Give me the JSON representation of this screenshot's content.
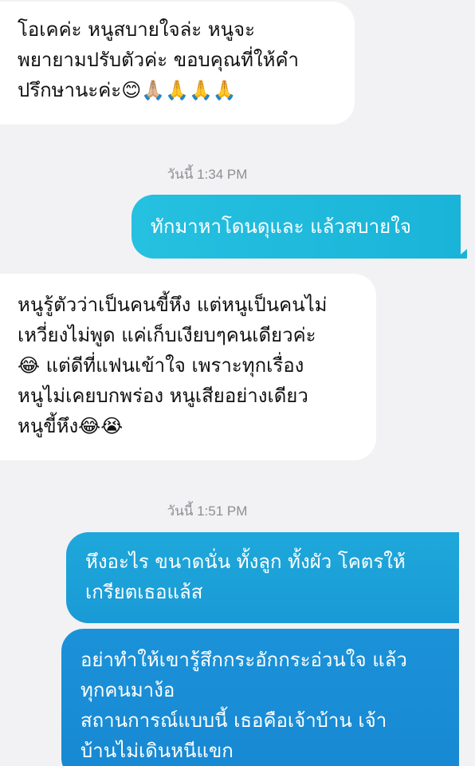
{
  "messages": [
    {
      "direction": "incoming",
      "text": "โอเคค่ะ หนูสบายใจล่ะ หนูจะ\nพยายามปรับตัวค่ะ ขอบคุณที่ให้คำ\nปรึกษานะค่ะ😊🙏🏼🙏🙏🙏"
    },
    {
      "direction": "outgoing",
      "text": "ทักมาหาโดนดุและ แล้วสบายใจ"
    },
    {
      "direction": "incoming",
      "text": "หนูรู้ตัวว่าเป็นคนขี้หึง แต่หนูเป็นคนไม่\nเหวี่ยงไม่พูด แค่เก็บเงียบๆคนเดียวค่ะ\n😂 แต่ดีที่แฟนเข้าใจ เพราะทุกเรื่อง\nหนูไม่เคยบกพร่อง หนูเสียอย่างเดียว\nหนูขี้หึง😂😭"
    },
    {
      "direction": "outgoing",
      "text": "หึงอะไร ขนาดนั่น ทั้งลูก ทั้งผัว โคตรให้\nเกรียตเธอแล้ส"
    },
    {
      "direction": "outgoing",
      "text": "อย่าทำให้เขารู้สึกกระอักกระอ่วนใจ แล้ว\nทุกคนมาง้อ\nสถานการณ์แบบนี้ เธอคือเจ้าบ้าน เจ้า\nบ้านไม่เดินหนีแขก"
    }
  ],
  "timestamps": [
    "วันนี้ 1:34 PM",
    "วันนี้ 1:51 PM"
  ],
  "colors": {
    "background": "#f2f2f4",
    "incoming_bubble": "#ffffff",
    "outgoing_bubble_light": "#1cb8dc",
    "outgoing_bubble_dark": "#1788d3",
    "timestamp_text": "#8e8e93"
  }
}
